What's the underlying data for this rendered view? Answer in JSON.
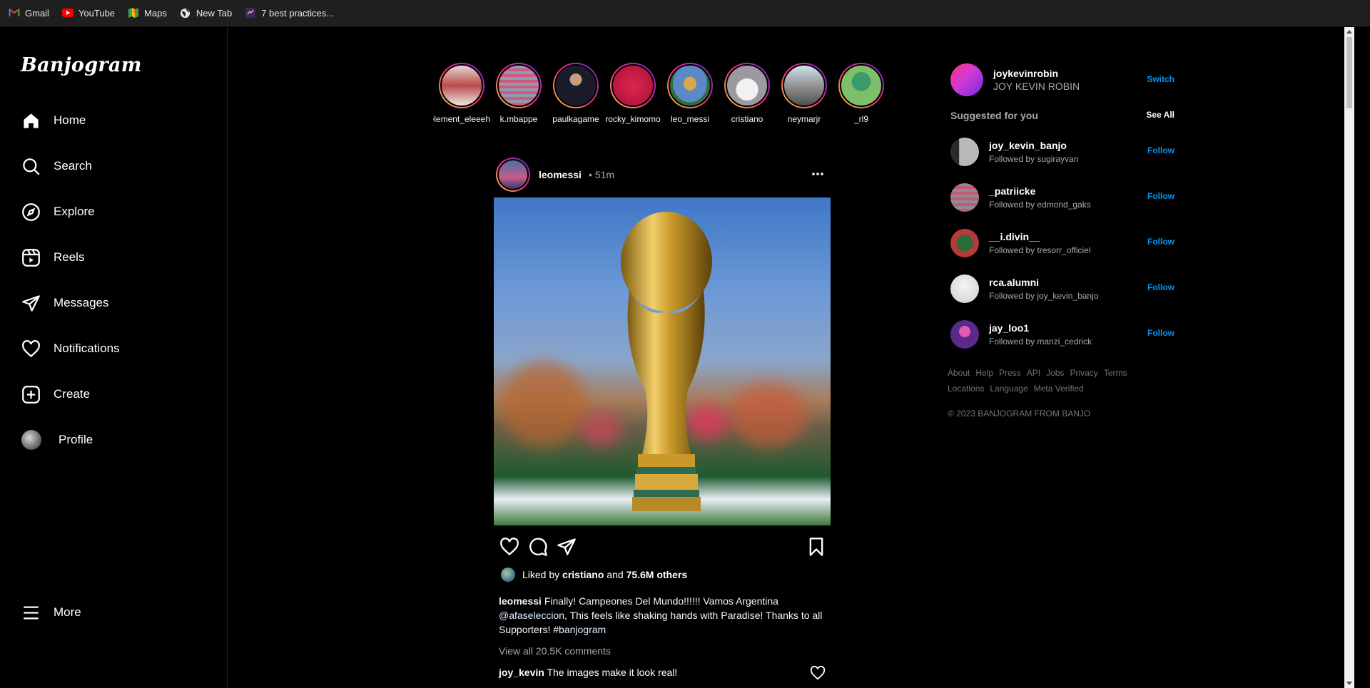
{
  "bookmarks": [
    {
      "label": "Gmail",
      "icon": "gmail-icon"
    },
    {
      "label": "YouTube",
      "icon": "youtube-icon"
    },
    {
      "label": "Maps",
      "icon": "maps-icon"
    },
    {
      "label": "New Tab",
      "icon": "globe-icon"
    },
    {
      "label": "7 best practices...",
      "icon": "page-icon"
    }
  ],
  "app": {
    "logo": "Banjogram"
  },
  "nav": {
    "home": "Home",
    "search": "Search",
    "explore": "Explore",
    "reels": "Reels",
    "messages": "Messages",
    "notifications": "Notifications",
    "create": "Create",
    "profile": "Profile",
    "more": "More"
  },
  "stories": [
    {
      "name": "element_eleeeh"
    },
    {
      "name": "k.mbappe"
    },
    {
      "name": "paulkagame"
    },
    {
      "name": "rocky_kimomo"
    },
    {
      "name": "leo_messi"
    },
    {
      "name": "cristiano"
    },
    {
      "name": "neymarjr"
    },
    {
      "name": "_rl9"
    }
  ],
  "post": {
    "user": "leomessi",
    "dot": "•",
    "time": "51m",
    "liked_prefix": "Liked by",
    "liked_user": "cristiano",
    "liked_and": "and",
    "liked_count": "75.6M others",
    "caption_user": "leomessi",
    "caption_text_1": "Finally! Campeones Del Mundo!!!!!! Vamos Argentina",
    "caption_mention": "@afaseleccion",
    "caption_text_2": ", This feels like shaking hands with Paradise! Thanks to all Supporters!",
    "caption_hashtag": "#banjogram",
    "view_comments": "View all 20.5K comments",
    "comment_user": "joy_kevin",
    "comment_text": "The images make it look real!"
  },
  "me": {
    "username": "joykevinrobin",
    "name": "JOY KEVIN ROBIN",
    "switch": "Switch"
  },
  "suggestions": {
    "title": "Suggested for you",
    "see_all": "See All",
    "follow_label": "Follow",
    "items": [
      {
        "username": "joy_kevin_banjo",
        "followed_by": "Followed by sugirayvan"
      },
      {
        "username": "_patriicke",
        "followed_by": "Followed by edmond_gaks"
      },
      {
        "username": "__i.divin__",
        "followed_by": "Followed by tresorr_officiel"
      },
      {
        "username": "rca.alumni",
        "followed_by": "Followed by joy_kevin_banjo"
      },
      {
        "username": "jay_loo1",
        "followed_by": "Followed by manzi_cedrick"
      }
    ]
  },
  "footer": {
    "links": [
      "About",
      "Help",
      "Press",
      "API",
      "Jobs",
      "Privacy",
      "Terms",
      "Locations",
      "Language",
      "Meta Verified"
    ],
    "copyright": "© 2023 BANJOGRAM FROM BANJO"
  },
  "colors": {
    "accent": "#0095f6",
    "background": "#000000",
    "muted": "#a8a8a8"
  }
}
